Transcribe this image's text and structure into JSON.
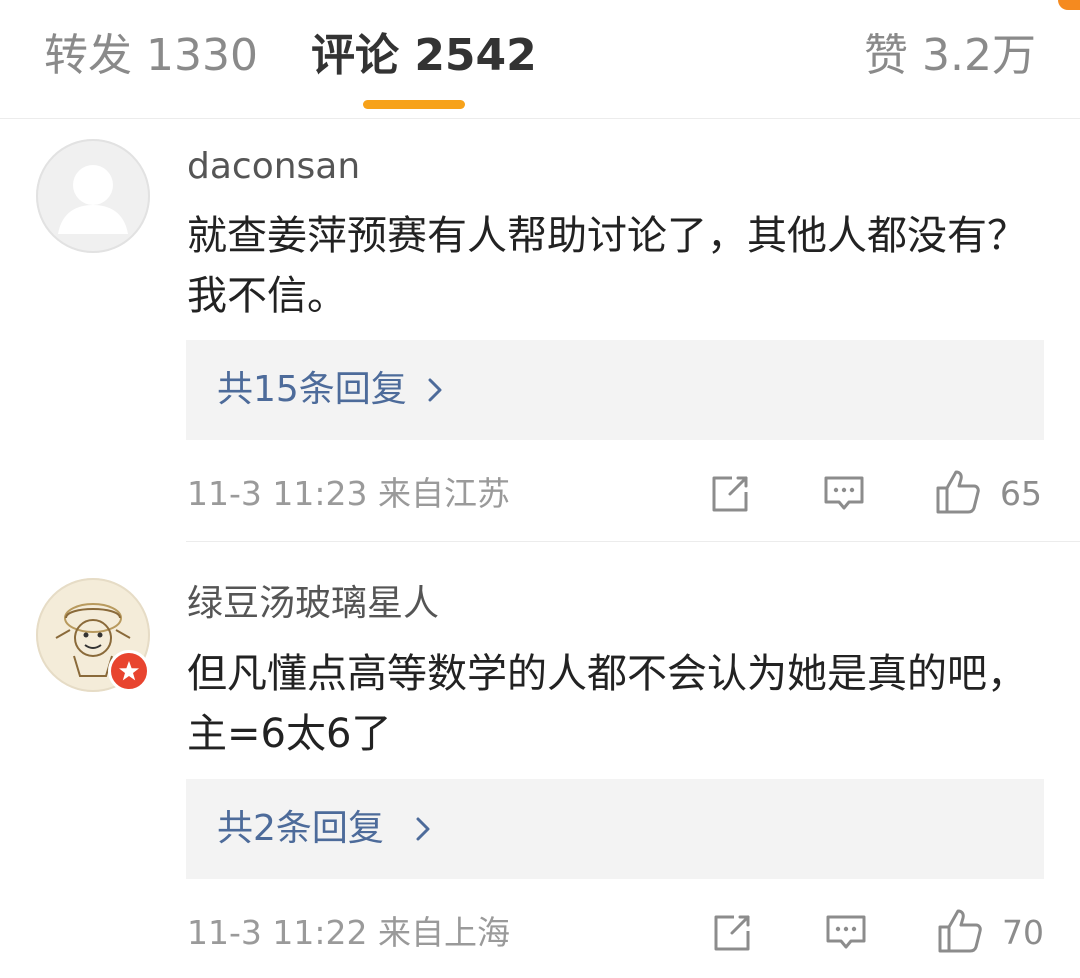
{
  "tabs": {
    "repost_label": "转发 1330",
    "comments_label": "评论 2542",
    "likes_label": "赞 3.2万"
  },
  "colors": {
    "accent": "#f7a21a",
    "reply_link": "#4d6b9a",
    "verified_badge": "#e8442f"
  },
  "comments": [
    {
      "username": "daconsan",
      "avatar_icon": "default-avatar-icon",
      "content": "就查姜萍预赛有人帮助讨论了，其他人都没有？我不信。",
      "reply_label": "共15条回复",
      "meta": "11-3 11:23 来自江苏",
      "likes": "65"
    },
    {
      "username": "绿豆汤玻璃星人",
      "avatar_icon": "sketch-avatar-icon",
      "content": "但凡懂点高等数学的人都不会认为她是真的吧，主=6太6了",
      "reply_label": "共2条回复",
      "meta": "11-3 11:22 来自上海",
      "likes": "70"
    }
  ]
}
